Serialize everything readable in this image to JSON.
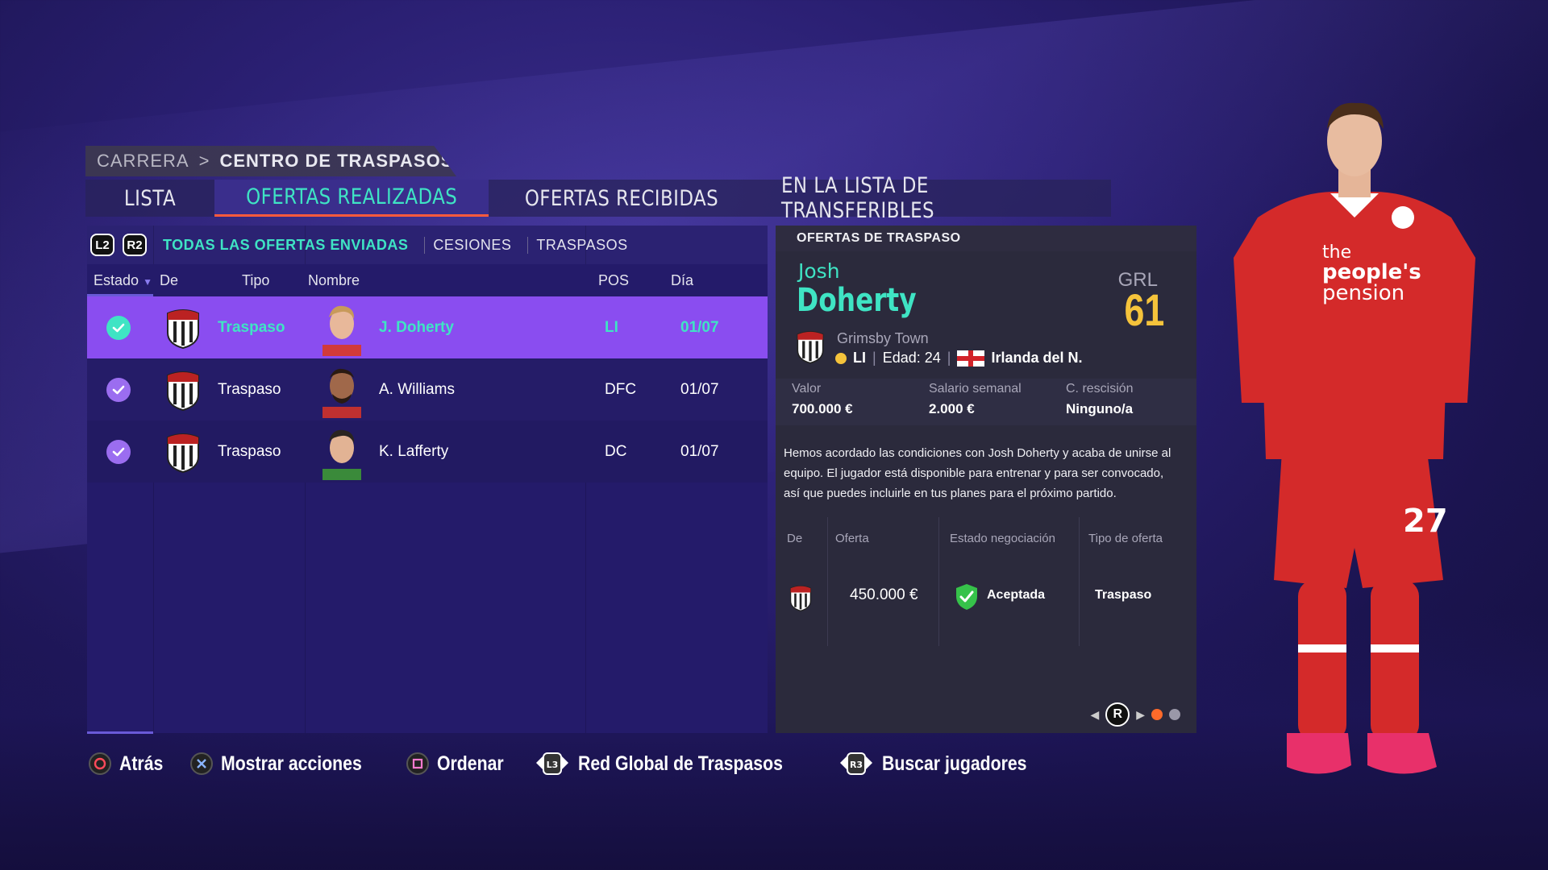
{
  "breadcrumb": {
    "parent": "CARRERA",
    "current": "CENTRO DE TRASPASOS"
  },
  "tabs": [
    {
      "label": "LISTA"
    },
    {
      "label": "OFERTAS REALIZADAS"
    },
    {
      "label": "OFERTAS RECIBIDAS"
    },
    {
      "label": "EN LA LISTA DE TRANSFERIBLES"
    }
  ],
  "filters": {
    "l2": "L2",
    "r2": "R2",
    "items": [
      "TODAS LAS OFERTAS ENVIADAS",
      "CESIONES",
      "TRASPASOS"
    ]
  },
  "columns": {
    "estado": "Estado",
    "de": "De",
    "tipo": "Tipo",
    "nombre": "Nombre",
    "pos": "POS",
    "dia": "Día"
  },
  "offers": [
    {
      "tipo": "Traspaso",
      "nombre": "J. Doherty",
      "pos": "LI",
      "dia": "01/07"
    },
    {
      "tipo": "Traspaso",
      "nombre": "A. Williams",
      "pos": "DFC",
      "dia": "01/07"
    },
    {
      "tipo": "Traspaso",
      "nombre": "K. Lafferty",
      "pos": "DC",
      "dia": "01/07"
    }
  ],
  "detail": {
    "header": "OFERTAS DE TRASPASO",
    "first_name": "Josh",
    "last_name": "Doherty",
    "grl_label": "GRL",
    "rating": "61",
    "club": "Grimsby Town",
    "position": "LI",
    "age_label": "Edad: 24",
    "nation": "Irlanda del N.",
    "stats": [
      {
        "label": "Valor",
        "value": "700.000 €"
      },
      {
        "label": "Salario semanal",
        "value": "2.000 €"
      },
      {
        "label": "C. rescisión",
        "value": "Ninguno/a"
      }
    ],
    "description": "Hemos acordado las condiciones con Josh Doherty y acaba de unirse al equipo. El jugador está disponible para entrenar y para ser convocado, así que puedes incluirle en tus planes para el próximo partido.",
    "offer_table": {
      "headers": {
        "de": "De",
        "oferta": "Oferta",
        "estado": "Estado negociación",
        "tipo": "Tipo de oferta"
      },
      "oferta": "450.000 €",
      "estado": "Aceptada",
      "tipo": "Traspaso"
    },
    "pager_button": "R"
  },
  "footer": [
    {
      "icon": "circle-button-icon",
      "label": "Atrás"
    },
    {
      "icon": "cross-button-icon",
      "label": "Mostrar acciones"
    },
    {
      "icon": "square-button-icon",
      "label": "Ordenar"
    },
    {
      "icon": "l3-stick-icon",
      "stick": "L3",
      "label": "Red Global de Traspasos"
    },
    {
      "icon": "r3-stick-icon",
      "stick": "R3",
      "label": "Buscar jugadores"
    }
  ],
  "colors": {
    "accent": "#3fe4c4",
    "selected_row": "#8a4df0",
    "rating": "#f5c33b",
    "tab_underline": "#ff5a3c"
  }
}
